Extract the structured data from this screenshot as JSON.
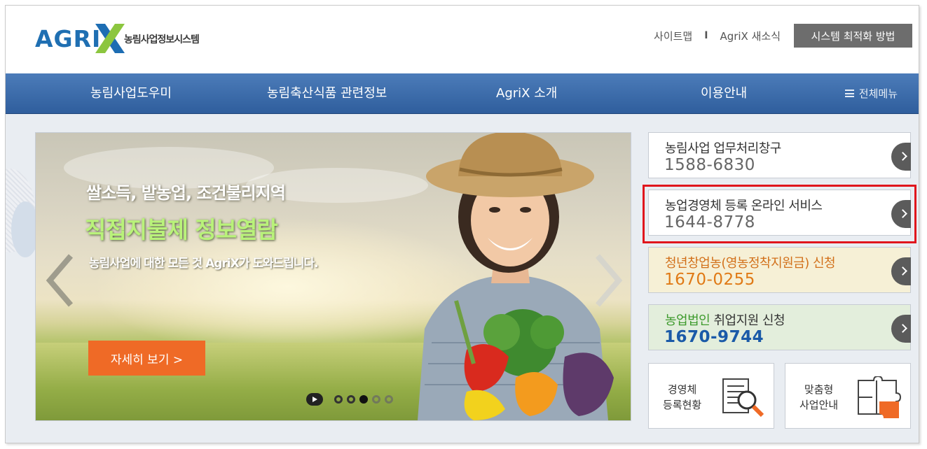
{
  "header": {
    "logo": {
      "brand": "AGRI",
      "mark": "X",
      "subtitle": "농림사업정보시스템"
    },
    "util_links": [
      {
        "label": "사이트맵"
      },
      {
        "label": "AgriX 새소식"
      }
    ],
    "separator": "I",
    "optimize_button": "시스템 최적화 방법"
  },
  "nav": {
    "items": [
      {
        "label": "농림사업도우미"
      },
      {
        "label": "농림축산식품 관련정보"
      },
      {
        "label": "AgriX 소개"
      },
      {
        "label": "이용안내"
      }
    ],
    "all_menu": "전체메뉴"
  },
  "banner": {
    "line1": "쌀소득, 밭농업, 조건불리지역",
    "line2": "직접지불제 정보열람",
    "line3": "농림사업에 대한 모든 것 AgriX가 도와드립니다.",
    "detail_button": "자세히 보기 >",
    "slides_total": 5,
    "active_slide": 3
  },
  "service_boxes": [
    {
      "title": "농림사업 업무처리창구",
      "title_highlight": "",
      "number": "1588-6830",
      "style": "white"
    },
    {
      "title": "농업경영체 등록 온라인 서비스",
      "title_highlight": "",
      "number": "1644-8778",
      "style": "white",
      "highlighted": true
    },
    {
      "title": "(영농정착지원금) 신청",
      "title_highlight": "청년창업농",
      "number": "1670-0255",
      "style": "yellow"
    },
    {
      "title": " 취업지원 신청",
      "title_highlight": "농업법인",
      "number": "1670-9744",
      "style": "green"
    }
  ],
  "tiles": [
    {
      "line1": "경영체",
      "line2": "등록현황",
      "icon": "document-search-icon"
    },
    {
      "line1": "맞춤형",
      "line2": "사업안내",
      "icon": "puzzle-icon"
    }
  ],
  "colors": {
    "nav_bg": "#3a69a8",
    "accent_orange": "#ef6a26",
    "highlight_red": "#e0161d",
    "yellow_box": "#f6f0d6",
    "yellow_text": "#d2701a",
    "green_box": "#e3eedc",
    "green_text": "#3d9a2c",
    "blue_number": "#1a5aa8"
  }
}
